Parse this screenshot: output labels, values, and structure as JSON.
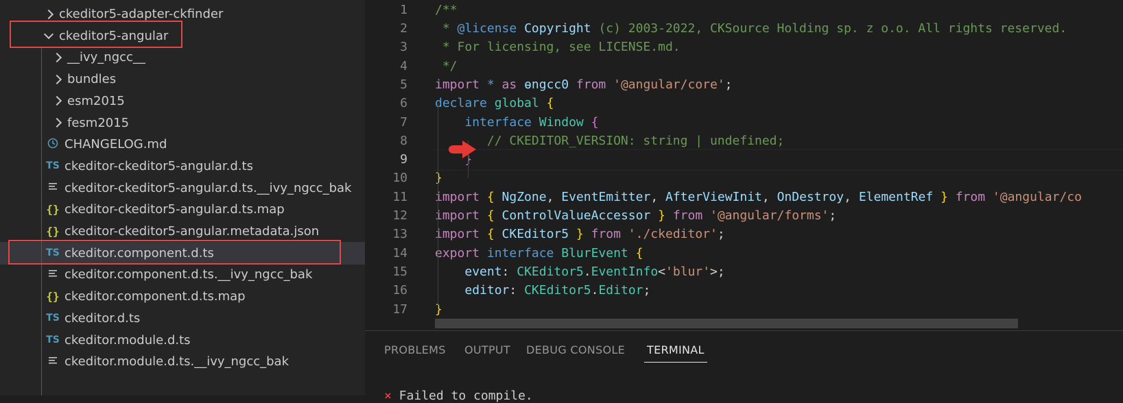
{
  "explorer": {
    "items": [
      {
        "label": "ckeditor5-adapter-ckfinder",
        "kind": "folder",
        "state": "collapsed"
      },
      {
        "label": "ckeditor5-angular",
        "kind": "folder",
        "state": "expanded"
      },
      {
        "label": "__ivy_ngcc__",
        "kind": "folder",
        "state": "collapsed"
      },
      {
        "label": "bundles",
        "kind": "folder",
        "state": "collapsed"
      },
      {
        "label": "esm2015",
        "kind": "folder",
        "state": "collapsed"
      },
      {
        "label": "fesm2015",
        "kind": "folder",
        "state": "collapsed"
      },
      {
        "label": "CHANGELOG.md",
        "kind": "file",
        "icon": "clock-icon"
      },
      {
        "label": "ckeditor-ckeditor5-angular.d.ts",
        "kind": "file",
        "icon": "ts-icon"
      },
      {
        "label": "ckeditor-ckeditor5-angular.d.ts.__ivy_ngcc_bak",
        "kind": "file",
        "icon": "lines-icon"
      },
      {
        "label": "ckeditor-ckeditor5-angular.d.ts.map",
        "kind": "file",
        "icon": "braces-icon"
      },
      {
        "label": "ckeditor-ckeditor5-angular.metadata.json",
        "kind": "file",
        "icon": "braces-icon"
      },
      {
        "label": "ckeditor.component.d.ts",
        "kind": "file",
        "icon": "ts-icon",
        "selected": true
      },
      {
        "label": "ckeditor.component.d.ts.__ivy_ngcc_bak",
        "kind": "file",
        "icon": "lines-icon"
      },
      {
        "label": "ckeditor.component.d.ts.map",
        "kind": "file",
        "icon": "braces-icon"
      },
      {
        "label": "ckeditor.d.ts",
        "kind": "file",
        "icon": "ts-icon"
      },
      {
        "label": "ckeditor.module.d.ts",
        "kind": "file",
        "icon": "ts-icon"
      },
      {
        "label": "ckeditor.module.d.ts.__ivy_ngcc_bak",
        "kind": "file",
        "icon": "lines-icon"
      }
    ],
    "ts_badge": "TS",
    "json_badge": "{}"
  },
  "editor": {
    "line_numbers": [
      "1",
      "2",
      "3",
      "4",
      "5",
      "6",
      "7",
      "8",
      "9",
      "10",
      "11",
      "12",
      "13",
      "14",
      "15",
      "16",
      "17"
    ],
    "active_line": "9",
    "lines": [
      [
        [
          "c",
          "/**"
        ]
      ],
      [
        [
          "c",
          " * "
        ],
        [
          "lic-kw",
          "@license "
        ],
        [
          "v",
          "Copyright "
        ],
        [
          "c",
          "(c) 2003-2022, CKSource Holding sp. z o.o. All rights reserved."
        ]
      ],
      [
        [
          "c",
          " * For licensing, see LICENSE.md."
        ]
      ],
      [
        [
          "c",
          " */"
        ]
      ],
      [
        [
          "p",
          "import "
        ],
        [
          "k",
          "* "
        ],
        [
          "p",
          "as "
        ],
        [
          "v",
          "ɵngcc0 "
        ],
        [
          "p",
          "from "
        ],
        [
          "s",
          "'@angular/core'"
        ],
        [
          "w",
          ";"
        ]
      ],
      [
        [
          "k",
          "declare "
        ],
        [
          "t",
          "global "
        ],
        [
          "br",
          "{"
        ]
      ],
      [
        [
          "w",
          "    "
        ],
        [
          "k",
          "interface "
        ],
        [
          "t",
          "Window "
        ],
        [
          "bv",
          "{"
        ]
      ],
      [
        [
          "w",
          "       "
        ],
        [
          "c",
          "// CKEDITOR_VERSION: string | undefined;"
        ]
      ],
      [
        [
          "w",
          "    "
        ],
        [
          "bv",
          "}"
        ]
      ],
      [
        [
          "br",
          "}"
        ]
      ],
      [
        [
          "p",
          "import "
        ],
        [
          "br",
          "{ "
        ],
        [
          "v",
          "NgZone"
        ],
        [
          "w",
          ", "
        ],
        [
          "v",
          "EventEmitter"
        ],
        [
          "w",
          ", "
        ],
        [
          "v",
          "AfterViewInit"
        ],
        [
          "w",
          ", "
        ],
        [
          "v",
          "OnDestroy"
        ],
        [
          "w",
          ", "
        ],
        [
          "v",
          "ElementRef "
        ],
        [
          "br",
          "} "
        ],
        [
          "p",
          "from "
        ],
        [
          "s",
          "'@angular/co"
        ]
      ],
      [
        [
          "p",
          "import "
        ],
        [
          "br",
          "{ "
        ],
        [
          "v",
          "ControlValueAccessor "
        ],
        [
          "br",
          "} "
        ],
        [
          "p",
          "from "
        ],
        [
          "s",
          "'@angular/forms'"
        ],
        [
          "w",
          ";"
        ]
      ],
      [
        [
          "p",
          "import "
        ],
        [
          "br",
          "{ "
        ],
        [
          "v",
          "CKEditor5 "
        ],
        [
          "br",
          "} "
        ],
        [
          "p",
          "from "
        ],
        [
          "s",
          "'./ckeditor'"
        ],
        [
          "w",
          ";"
        ]
      ],
      [
        [
          "p",
          "export "
        ],
        [
          "k",
          "interface "
        ],
        [
          "t",
          "BlurEvent "
        ],
        [
          "br",
          "{"
        ]
      ],
      [
        [
          "w",
          "    "
        ],
        [
          "v",
          "event"
        ],
        [
          "w",
          ": "
        ],
        [
          "t",
          "CKEditor5"
        ],
        [
          "w",
          "."
        ],
        [
          "t",
          "EventInfo"
        ],
        [
          "w",
          "<"
        ],
        [
          "s",
          "'blur'"
        ],
        [
          "w",
          ">;"
        ]
      ],
      [
        [
          "w",
          "    "
        ],
        [
          "v",
          "editor"
        ],
        [
          "w",
          ": "
        ],
        [
          "t",
          "CKEditor5"
        ],
        [
          "w",
          "."
        ],
        [
          "t",
          "Editor"
        ],
        [
          "w",
          ";"
        ]
      ],
      [
        [
          "br",
          "}"
        ]
      ]
    ]
  },
  "panel": {
    "tabs": [
      "PROBLEMS",
      "OUTPUT",
      "DEBUG CONSOLE",
      "TERMINAL"
    ],
    "active_tab": "TERMINAL",
    "terminal_x": "×",
    "terminal_text": " Failed to compile."
  },
  "colors": {
    "annotation_red": "#e04848",
    "selected_row": "#37373d"
  }
}
